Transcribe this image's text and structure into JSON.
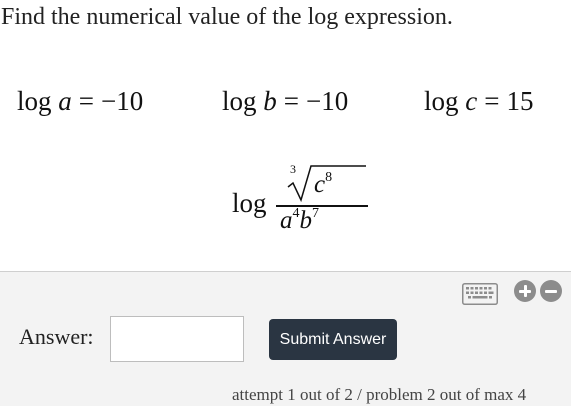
{
  "question": {
    "prompt": "Find the numerical value of the log expression.",
    "givens": [
      {
        "fn": "log",
        "var": "a",
        "op": "=",
        "value": "−10"
      },
      {
        "fn": "log",
        "var": "b",
        "op": "=",
        "value": "−10"
      },
      {
        "fn": "log",
        "var": "c",
        "op": "=",
        "value": "15"
      }
    ],
    "expression": {
      "fn": "log",
      "numerator": {
        "root_index": "3",
        "base": "c",
        "exponent": "8"
      },
      "denominator": {
        "base1": "a",
        "exp1": "4",
        "base2": "b",
        "exp2": "7"
      }
    }
  },
  "answer_panel": {
    "keyboard_icon": "keyboard-icon",
    "zoom_in_icon": "plus-circle-icon",
    "zoom_out_icon": "minus-circle-icon",
    "label": "Answer:",
    "input_value": "",
    "input_placeholder": "",
    "submit_label": "Submit Answer",
    "attempt_text": "attempt 1 out of 2 / problem 2 out of max 4"
  },
  "colors": {
    "submit_bg": "#2a3542",
    "panel_bg": "#f3f3f3",
    "icon_gray": "#8c8c8c"
  }
}
